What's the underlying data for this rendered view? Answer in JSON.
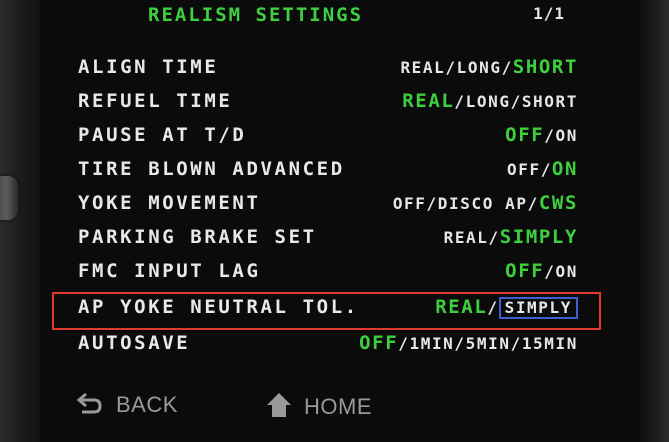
{
  "header": {
    "title": "REALISM SETTINGS",
    "page": "1/1"
  },
  "settings": [
    {
      "label": "ALIGN TIME",
      "options": [
        "REAL",
        "LONG",
        "SHORT"
      ],
      "selected": 2
    },
    {
      "label": "REFUEL TIME",
      "options": [
        "REAL",
        "LONG",
        "SHORT"
      ],
      "selected": 0
    },
    {
      "label": "PAUSE AT T/D",
      "options": [
        "OFF",
        "ON"
      ],
      "selected": 0
    },
    {
      "label": "TIRE BLOWN ADVANCED",
      "options": [
        "OFF",
        "ON"
      ],
      "selected": 1
    },
    {
      "label": "YOKE MOVEMENT",
      "options": [
        "OFF",
        "DISCO AP",
        "CWS"
      ],
      "selected": 2
    },
    {
      "label": "PARKING BRAKE SET",
      "options": [
        "REAL",
        "SIMPLY"
      ],
      "selected": 1
    },
    {
      "label": "FMC INPUT LAG",
      "options": [
        "OFF",
        "ON"
      ],
      "selected": 0
    },
    {
      "label": "AP YOKE NEUTRAL TOL.",
      "options": [
        "REAL",
        "SIMPLY"
      ],
      "selected": 0,
      "cursor": 1,
      "highlighted": true
    },
    {
      "label": "AUTOSAVE",
      "options": [
        "OFF",
        "1MIN",
        "5MIN",
        "15MIN"
      ],
      "selected": 0
    }
  ],
  "footer": {
    "back_label": "BACK",
    "back_icon": "back-arrow-icon",
    "home_label": "HOME",
    "home_icon": "home-icon"
  },
  "colors": {
    "selected": "#3ecf3e",
    "text": "#e8e8e8",
    "cursor_box": "#3b5fd0",
    "highlight_box": "#e0392d"
  }
}
